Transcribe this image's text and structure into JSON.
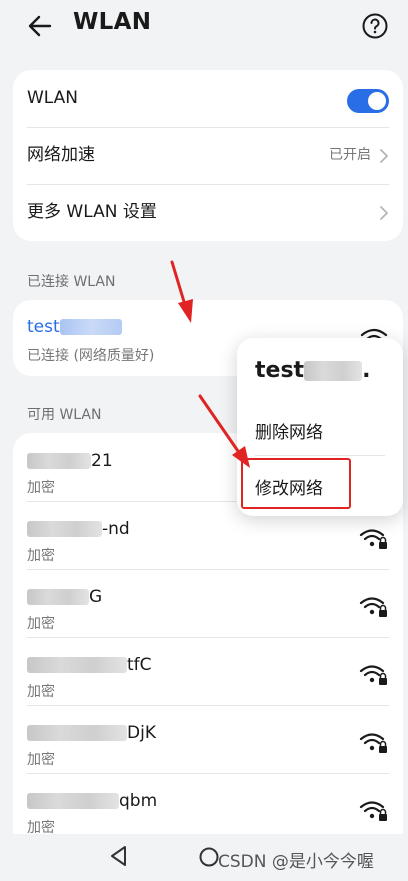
{
  "header": {
    "title": "WLAN",
    "back_icon": "arrow-left-icon",
    "help_icon": "question-circle-icon"
  },
  "settings": {
    "wlan_label": "WLAN",
    "wlan_enabled": true,
    "accel_label": "网络加速",
    "accel_value": "已开启",
    "more_label": "更多 WLAN 设置"
  },
  "connected": {
    "section_label": "已连接 WLAN",
    "name_prefix": "test",
    "status": "已连接 (网络质量好)"
  },
  "available": {
    "section_label": "可用 WLAN",
    "networks": [
      {
        "name_suffix": "21",
        "security": "加密"
      },
      {
        "name_suffix": "-nd",
        "security": "加密"
      },
      {
        "name_suffix": "G",
        "security": "加密"
      },
      {
        "name_suffix": "tfC",
        "security": "加密"
      },
      {
        "name_suffix": "DjK",
        "security": "加密"
      },
      {
        "name_suffix": "qbm",
        "security": "加密"
      }
    ]
  },
  "popup": {
    "title_prefix": "test",
    "title_suffix": ".",
    "delete_label": "删除网络",
    "modify_label": "修改网络"
  },
  "colors": {
    "accent": "#2a6ee7",
    "annotation": "#e02424"
  },
  "watermark": "CSDN @是小今今喔"
}
